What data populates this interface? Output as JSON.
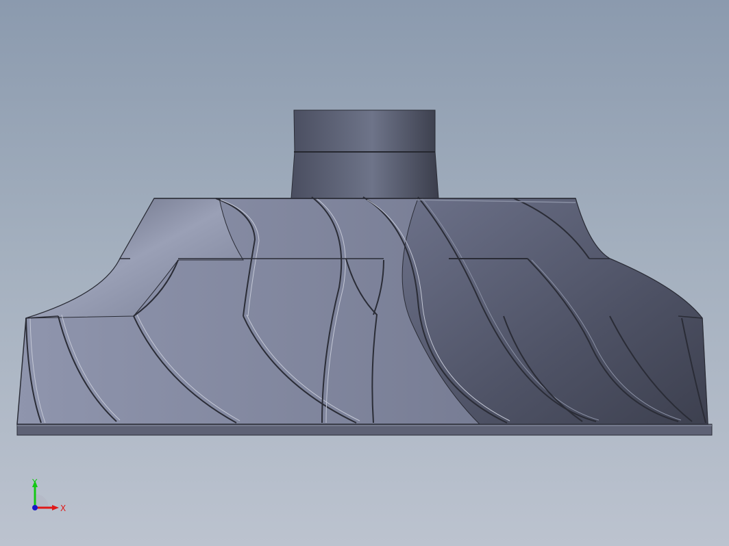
{
  "viewport": {
    "background_top": "#8b9aae",
    "background_bottom": "#bcc3cf",
    "model": {
      "name": "impeller",
      "blade_count": 12,
      "colors": {
        "body": "#6b7187",
        "dark": "#474b5b",
        "light": "#9aa0b6",
        "edge": "#2a2c36"
      }
    },
    "triad": {
      "y_label": "Y",
      "x_label": "X",
      "y_color": "#14c814",
      "x_color": "#e01818",
      "origin_color": "#1818c8"
    }
  }
}
